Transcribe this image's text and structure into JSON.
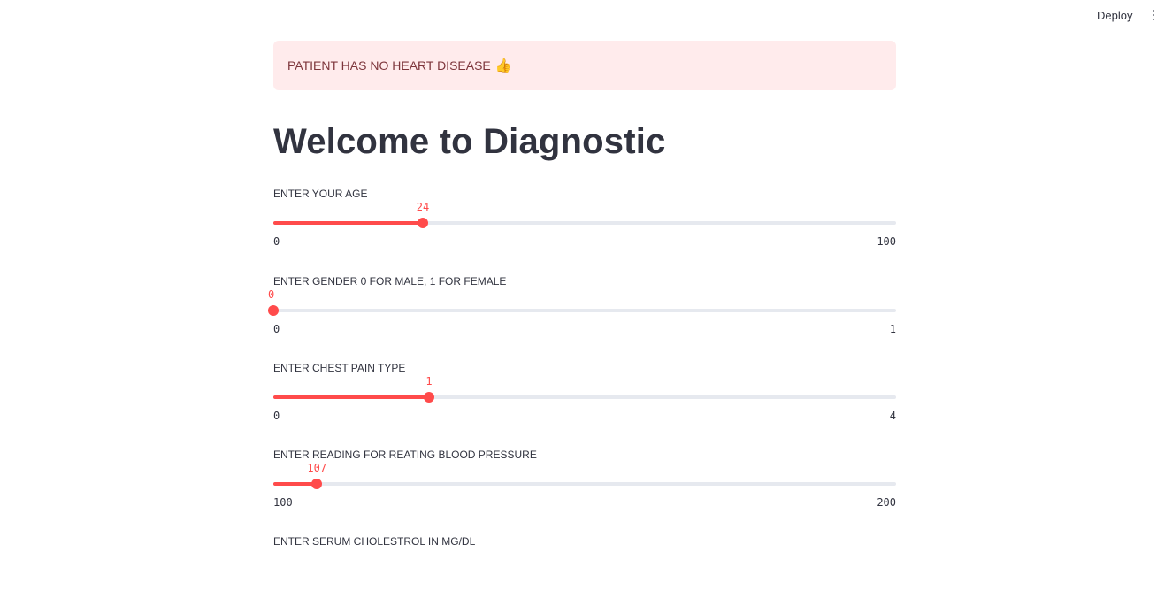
{
  "header": {
    "deploy_label": "Deploy",
    "menu_icon": "kebab-menu-icon"
  },
  "result_alert": {
    "text": "PATIENT HAS NO HEART DISEASE",
    "emoji": "👍",
    "background_color": "#ffebec",
    "text_color": "#7d353b"
  },
  "page": {
    "title": "Welcome to Diagnostic"
  },
  "accent_color": "#ff4b4b",
  "sliders": [
    {
      "label": "ENTER YOUR AGE",
      "value": "24",
      "min": "0",
      "max": "100",
      "fraction": 0.24
    },
    {
      "label": "ENTER GENDER 0 FOR MALE, 1 FOR FEMALE",
      "value": "0",
      "min": "0",
      "max": "1",
      "fraction": 0.0
    },
    {
      "label": "ENTER CHEST PAIN TYPE",
      "value": "1",
      "min": "0",
      "max": "4",
      "fraction": 0.25
    },
    {
      "label": "ENTER READING FOR REATING BLOOD PRESSURE",
      "value": "107",
      "min": "100",
      "max": "200",
      "fraction": 0.07
    },
    {
      "label": "ENTER SERUM CHOLESTROL IN MG/DL"
    }
  ]
}
